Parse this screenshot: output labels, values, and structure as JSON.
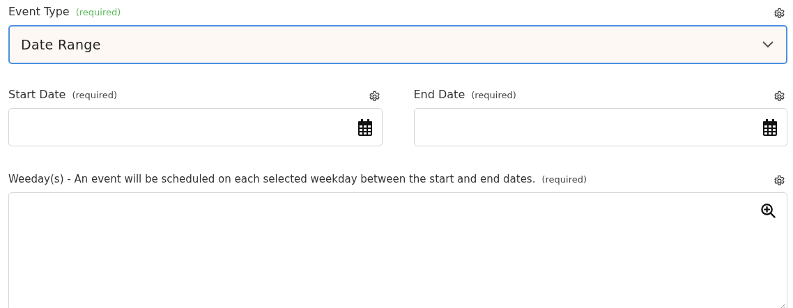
{
  "fields": [
    {
      "kind": "select",
      "label": "Event Type",
      "required_note": "(required)",
      "focused": true,
      "value": "Date Range"
    },
    {
      "kind": "date",
      "label": "Start Date",
      "required_note": "(required)",
      "focused": false
    },
    {
      "kind": "date",
      "label": "End Date",
      "required_note": "(required)",
      "focused": false
    },
    {
      "kind": "textarea",
      "label": "Weeday(s) - An event will be scheduled on each selected weekday between the start and end dates.",
      "required_note": "(required)",
      "focused": false
    }
  ]
}
